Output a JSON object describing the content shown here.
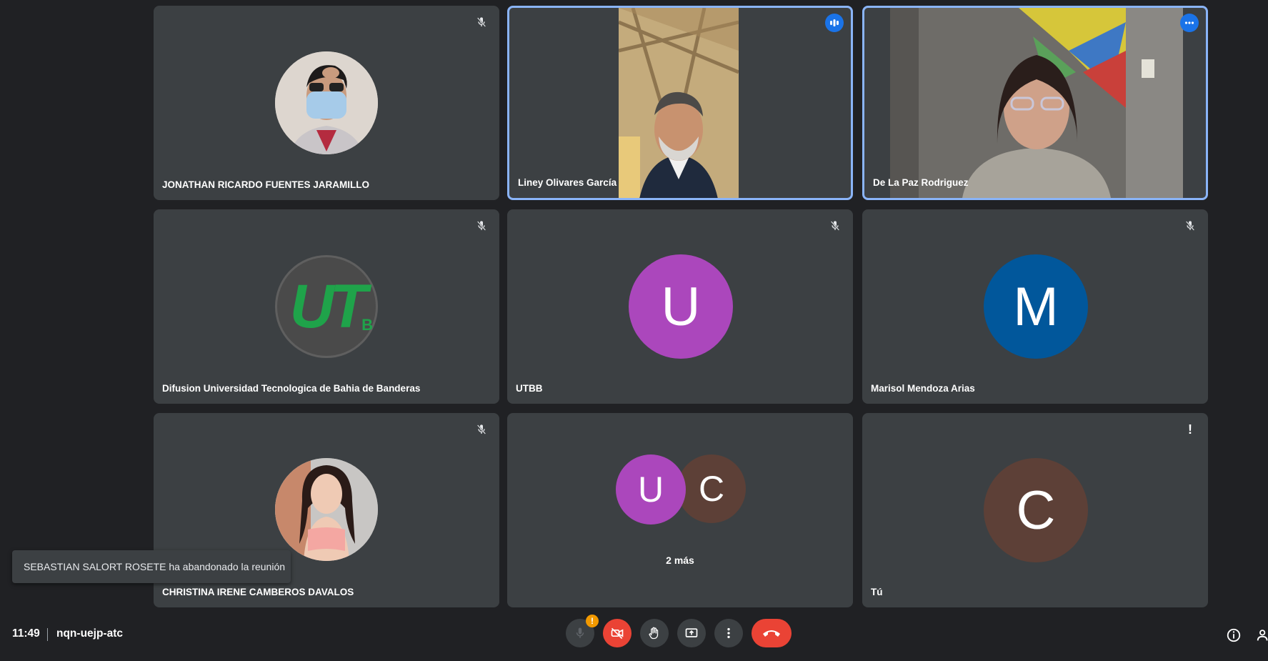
{
  "participants": [
    {
      "name": "JONATHAN RICARDO FUENTES JARAMILLO",
      "muted": true
    },
    {
      "name": "Liney Olivares García",
      "speaking": true
    },
    {
      "name": "De La Paz Rodriguez",
      "speaking": true
    },
    {
      "name": "Difusion Universidad Tecnologica de Bahia de Banderas",
      "muted": true,
      "logo_text": "UT",
      "logo_sub": "B"
    },
    {
      "name": "UTBB",
      "muted": true,
      "initial": "U",
      "color": "#ab47bc"
    },
    {
      "name": "Marisol Mendoza Arias",
      "muted": true,
      "initial": "M",
      "color": "#01579b"
    },
    {
      "name": "CHRISTINA IRENE CAMBEROS DAVALOS",
      "muted": true
    },
    {
      "group_initials": [
        "U",
        "C"
      ],
      "group_colors": [
        "#ab47bc",
        "#5d4037"
      ],
      "more_label": "2 más"
    },
    {
      "name": "Tú",
      "initial": "C",
      "color": "#5d4037",
      "alert": "!"
    }
  ],
  "toast": {
    "message": "SEBASTIAN SALORT ROSETE ha abandonado la reunión"
  },
  "meeting": {
    "time": "11:49",
    "code": "nqn-uejp-atc"
  },
  "controls": {
    "mic_warning": "!"
  },
  "colors": {
    "accent": "#8ab4f8",
    "end_call": "#ea4335",
    "tile_bg": "#3c4043",
    "page_bg": "#202124"
  }
}
